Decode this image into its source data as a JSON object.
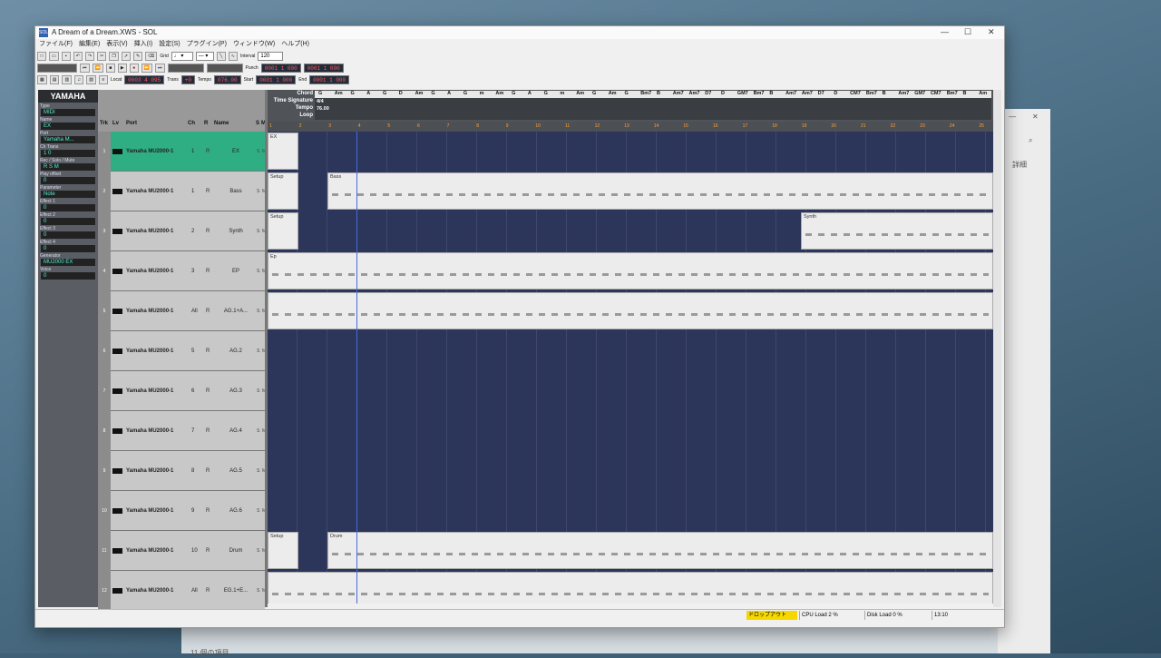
{
  "window": {
    "title": "A Dream of a Dream.XWS - SOL",
    "icon_label": "SOL"
  },
  "menu": [
    "ファイル(F)",
    "編集(E)",
    "表示(V)",
    "挿入(I)",
    "設定(S)",
    "プラグイン(P)",
    "ウィンドウ(W)",
    "ヘルプ(H)"
  ],
  "toolbar": {
    "grid_label": "Grid",
    "interval_label": "Interval",
    "interval_value": "120",
    "punch_label": "Punch",
    "locat_label": "Locat",
    "locat_value": "0003 4 095",
    "trans_label": "Trans",
    "trans_value": "+0",
    "tempo_label": "Tempo",
    "tempo_value": "076.00",
    "loop_start_label": "Start",
    "loop_start_value": "0001 1 000",
    "loop_end_label": "End",
    "loop_end_value": "0001 1 000",
    "punch_in_value": "0001 1 000",
    "punch_out_value": "0001 1 000"
  },
  "inspector": {
    "logo": "YAMAHA",
    "type_label": "Type",
    "type_value": "MIDI",
    "name_label": "Name",
    "name_value": "EX",
    "port_label": "Port",
    "port_value": "Yamaha M...",
    "ch_label": "Ch",
    "trans_label": "Trans",
    "ch_value": "1",
    "trans_value": "0",
    "rec_label": "Rec / Solo / Mute",
    "r": "R",
    "s": "S",
    "m": "M",
    "offset_label": "Play offset",
    "offset_value": "0",
    "param_label": "Parameter",
    "param_value": "Note",
    "fx1": "Effect 1",
    "fx2": "Effect 2",
    "fx3": "Effect 3",
    "fx4": "Effect 4",
    "gen_label": "Generator",
    "gen_value": "MU2000 EX",
    "voice_label": "Voice",
    "zero": "0"
  },
  "columns": {
    "trk": "Trk",
    "lv": "Lv",
    "port": "Port",
    "ch": "Ch",
    "r": "R",
    "name": "Name",
    "s": "S",
    "m": "M"
  },
  "tracks": [
    {
      "num": "1",
      "port": "Yamaha MU2000-1",
      "ch": "1",
      "r": "R",
      "name": "EX",
      "s": "S",
      "m": "M"
    },
    {
      "num": "2",
      "port": "Yamaha MU2000-1",
      "ch": "1",
      "r": "R",
      "name": "Bass",
      "s": "S",
      "m": "M"
    },
    {
      "num": "3",
      "port": "Yamaha MU2000-1",
      "ch": "2",
      "r": "R",
      "name": "Synth",
      "s": "S",
      "m": "M"
    },
    {
      "num": "4",
      "port": "Yamaha MU2000-1",
      "ch": "3",
      "r": "R",
      "name": "EP",
      "s": "S",
      "m": "M"
    },
    {
      "num": "5",
      "port": "Yamaha MU2000-1",
      "ch": "All",
      "r": "R",
      "name": "AG.1+A...",
      "s": "S",
      "m": "M"
    },
    {
      "num": "6",
      "port": "Yamaha MU2000-1",
      "ch": "5",
      "r": "R",
      "name": "AG.2",
      "s": "S",
      "m": "M"
    },
    {
      "num": "7",
      "port": "Yamaha MU2000-1",
      "ch": "6",
      "r": "R",
      "name": "AG.3",
      "s": "S",
      "m": "M"
    },
    {
      "num": "8",
      "port": "Yamaha MU2000-1",
      "ch": "7",
      "r": "R",
      "name": "AG.4",
      "s": "S",
      "m": "M"
    },
    {
      "num": "9",
      "port": "Yamaha MU2000-1",
      "ch": "8",
      "r": "R",
      "name": "AG.5",
      "s": "S",
      "m": "M"
    },
    {
      "num": "10",
      "port": "Yamaha MU2000-1",
      "ch": "9",
      "r": "R",
      "name": "AG.6",
      "s": "S",
      "m": "M"
    },
    {
      "num": "11",
      "port": "Yamaha MU2000-1",
      "ch": "10",
      "r": "R",
      "name": "Drum",
      "s": "S",
      "m": "M"
    },
    {
      "num": "12",
      "port": "Yamaha MU2000-1",
      "ch": "All",
      "r": "R",
      "name": "EG.1+E...",
      "s": "S",
      "m": "M"
    }
  ],
  "ruler": {
    "chord_label": "Chord",
    "timesig_label": "Time Signature",
    "tempo_label": "Tempo",
    "loop_label": "Loop",
    "timesig_value": "4/4",
    "tempo_value": "76.00",
    "chords": [
      "G",
      "Am",
      "G",
      "A",
      "G",
      "D",
      "Am",
      "G",
      "A",
      "G",
      "m",
      "Am",
      "G",
      "A",
      "G",
      "m",
      "Am",
      "G",
      "Am",
      "G",
      "Bm7",
      "B",
      "Am7",
      "Am7",
      "D7",
      "D",
      "GM7",
      "Bm7",
      "B",
      "Am7",
      "Am7",
      "D7",
      "D",
      "CM7",
      "Bm7",
      "B",
      "Am7",
      "GM7",
      "CM7",
      "Bm7",
      "B",
      "Am"
    ],
    "bars": [
      "1",
      "2",
      "3",
      "4",
      "5",
      "6",
      "7",
      "8",
      "9",
      "10",
      "11",
      "12",
      "13",
      "14",
      "15",
      "16",
      "17",
      "18",
      "19",
      "20",
      "21",
      "22",
      "23",
      "24",
      "25"
    ]
  },
  "parts": {
    "ex": "EX",
    "setup": "Setup",
    "bass": "Bass",
    "synth": "Synth",
    "ep": "Ep",
    "drum": "Drum"
  },
  "status": {
    "dropout": "ドロップアウト",
    "cpu": "CPU Load 2 %",
    "disk": "Disk Load 0 %",
    "time": "13:10"
  },
  "desktop": {
    "detail": "詳細",
    "taskbar_text": "11 個の項目"
  }
}
